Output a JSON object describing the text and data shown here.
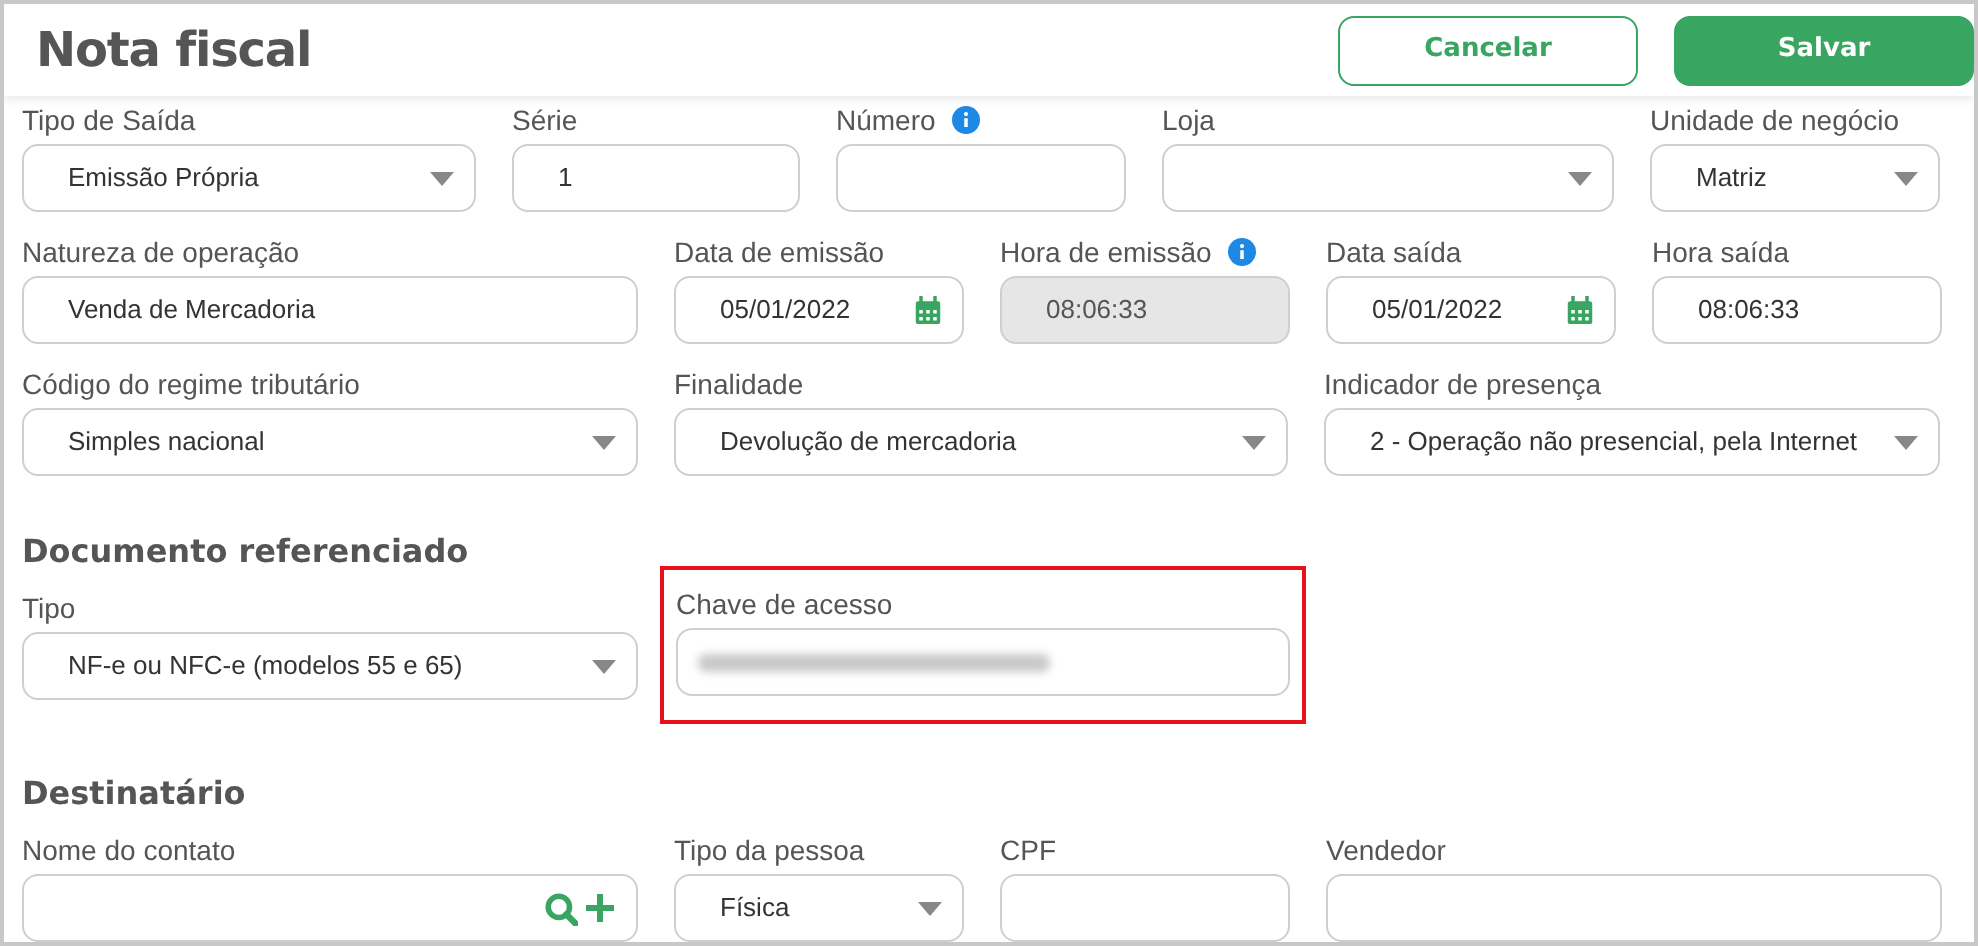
{
  "header": {
    "title": "Nota fiscal",
    "buttons": [
      {
        "label": "Cancelar",
        "kind": "secondary"
      },
      {
        "label": "Salvar",
        "kind": "primary"
      }
    ]
  },
  "sections": [
    {
      "fields": [
        {
          "label": "Tipo de Saída",
          "kind": "select",
          "value": "Emissão Própria"
        },
        {
          "label": "Série",
          "kind": "text",
          "value": "1"
        },
        {
          "label": "Número",
          "kind": "text",
          "info": true
        },
        {
          "label": "Loja",
          "kind": "select"
        },
        {
          "label": "Unidade de negócio",
          "kind": "select",
          "value": "Matriz"
        },
        {
          "label": "Natureza de operação",
          "kind": "text",
          "value": "Venda de Mercadoria"
        },
        {
          "label": "Data de emissão",
          "kind": "date",
          "value": "05/01/2022"
        },
        {
          "label": "Hora de emissão",
          "kind": "text",
          "value": "08:06:33",
          "info": true,
          "disabled": true
        },
        {
          "label": "Data saída",
          "kind": "date",
          "value": "05/01/2022"
        },
        {
          "label": "Hora saída",
          "kind": "text",
          "value": "08:06:33"
        },
        {
          "label": "Código do regime tributário",
          "kind": "select",
          "value": "Simples nacional"
        },
        {
          "label": "Finalidade",
          "kind": "select",
          "value": "Devolução de mercadoria"
        },
        {
          "label": "Indicador de presença",
          "kind": "select",
          "value": "2 - Operação não presencial, pela Internet"
        }
      ]
    },
    {
      "heading": "Documento referenciado",
      "fields": [
        {
          "label": "Tipo",
          "kind": "select",
          "value": "NF-e ou NFC-e (modelos 55 e 65)"
        },
        {
          "label": "Chave de acesso",
          "kind": "redacted",
          "highlighted": true
        }
      ]
    },
    {
      "heading": "Destinatário",
      "fields": [
        {
          "label": "Nome do contato",
          "kind": "contact"
        },
        {
          "label": "Tipo da pessoa",
          "kind": "select",
          "value": "Física"
        },
        {
          "label": "CPF",
          "kind": "text"
        },
        {
          "label": "Vendedor",
          "kind": "text"
        }
      ]
    }
  ]
}
